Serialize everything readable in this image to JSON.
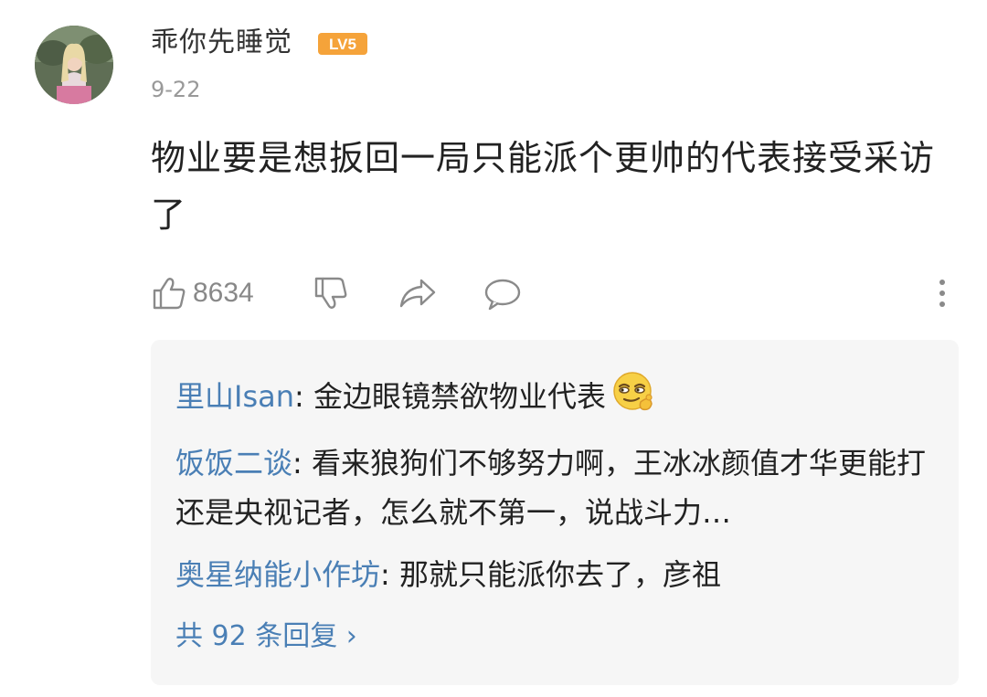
{
  "comment": {
    "username": "乖你先睡觉",
    "level": "LV5",
    "date": "9-22",
    "text": "物业要是想扳回一局只能派个更帅的代表接受采访了",
    "like_count": "8634",
    "icons": {
      "like": "thumbs-up-icon",
      "dislike": "thumbs-down-icon",
      "share": "share-icon",
      "reply": "comment-bubble-icon",
      "more": "more-vertical-icon"
    }
  },
  "replies": {
    "items": [
      {
        "name": "里山Isan",
        "separator": ": ",
        "text": "金边眼镜禁欲物业代表",
        "emoji": "smirk-emoji-icon"
      },
      {
        "name": "饭饭二谈",
        "separator": ": ",
        "text": "看来狼狗们不够努力啊，王冰冰颜值才华更能打还是央视记者，怎么就不第一，说战斗力…"
      },
      {
        "name": "奥星纳能小作坊",
        "separator": ": ",
        "text": "那就只能派你去了，彦祖"
      }
    ],
    "more_label": "共 92 条回复 ›"
  },
  "colors": {
    "link_blue": "#4a7fb5",
    "badge_orange": "#f5a33a",
    "muted_gray": "#999999",
    "reply_bg": "#f6f6f6"
  }
}
